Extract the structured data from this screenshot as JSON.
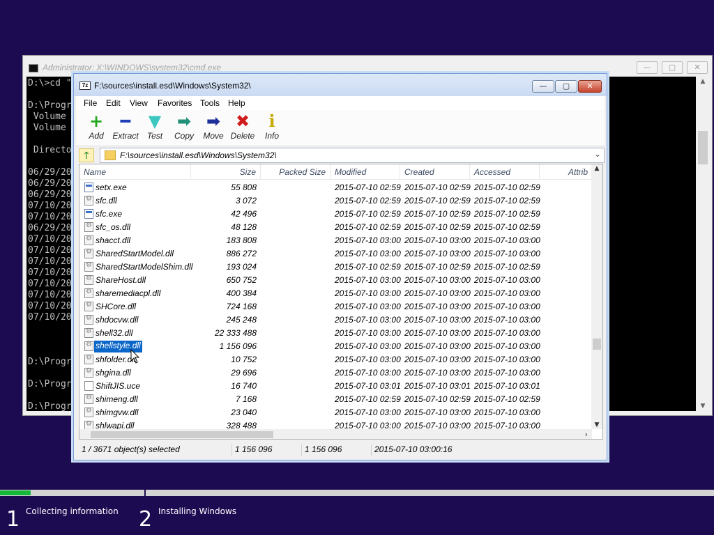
{
  "cmd": {
    "title": "Administrator: X:\\WINDOWS\\system32\\cmd.exe",
    "min_glyph": "—",
    "max_glyph": "▢",
    "close_glyph": "✕",
    "lines": [
      "D:\\>cd \"",
      "",
      "D:\\Progr",
      " Volume",
      " Volume",
      "",
      " Directo",
      "",
      "06/29/20",
      "06/29/20",
      "06/29/20",
      "07/10/20",
      "07/10/20",
      "06/29/20",
      "07/10/20",
      "07/10/20",
      "07/10/20",
      "07/10/20",
      "07/10/20",
      "07/10/20",
      "07/10/20",
      "07/10/20",
      "",
      "",
      "",
      "D:\\Progr",
      "",
      "D:\\Progr",
      "",
      "D:\\Progr"
    ]
  },
  "filemanager": {
    "app_icon": "7z",
    "title": "F:\\sources\\install.esd\\Windows\\System32\\",
    "min_glyph": "—",
    "max_glyph": "▢",
    "close_glyph": "✕",
    "menu": [
      "File",
      "Edit",
      "View",
      "Favorites",
      "Tools",
      "Help"
    ],
    "toolbar": [
      {
        "label": "Add",
        "icon": "plus-icon",
        "glyph": "+",
        "color": "#23a81e"
      },
      {
        "label": "Extract",
        "icon": "minus-icon",
        "glyph": "━",
        "color": "#1f3fb4"
      },
      {
        "label": "Test",
        "icon": "check-icon",
        "glyph": "▼",
        "color": "#3cc8c0"
      },
      {
        "label": "Copy",
        "icon": "copy-arrow-icon",
        "glyph": "➡",
        "color": "#23907a"
      },
      {
        "label": "Move",
        "icon": "move-arrow-icon",
        "glyph": "➡",
        "color": "#1f2f9a"
      },
      {
        "label": "Delete",
        "icon": "delete-x-icon",
        "glyph": "✖",
        "color": "#d01c1c"
      },
      {
        "label": "Info",
        "icon": "info-icon",
        "glyph": "i",
        "color": "#c8a800"
      }
    ],
    "address": "F:\\sources\\install.esd\\Windows\\System32\\",
    "up_glyph": "↑",
    "dropdown_glyph": "⌄",
    "columns": {
      "name": "Name",
      "size": "Size",
      "packed": "Packed Size",
      "modified": "Modified",
      "created": "Created",
      "accessed": "Accessed",
      "attrib": "Attrib"
    },
    "rows": [
      {
        "icon": "exe",
        "name": "setx.exe",
        "size": "55 808",
        "modified": "2015-07-10 02:59",
        "created": "2015-07-10 02:59",
        "accessed": "2015-07-10 02:59"
      },
      {
        "icon": "dll",
        "name": "sfc.dll",
        "size": "3 072",
        "modified": "2015-07-10 02:59",
        "created": "2015-07-10 02:59",
        "accessed": "2015-07-10 02:59"
      },
      {
        "icon": "exe",
        "name": "sfc.exe",
        "size": "42 496",
        "modified": "2015-07-10 02:59",
        "created": "2015-07-10 02:59",
        "accessed": "2015-07-10 02:59"
      },
      {
        "icon": "dll",
        "name": "sfc_os.dll",
        "size": "48 128",
        "modified": "2015-07-10 02:59",
        "created": "2015-07-10 02:59",
        "accessed": "2015-07-10 02:59"
      },
      {
        "icon": "dll",
        "name": "shacct.dll",
        "size": "183 808",
        "modified": "2015-07-10 03:00",
        "created": "2015-07-10 03:00",
        "accessed": "2015-07-10 03:00"
      },
      {
        "icon": "dll",
        "name": "SharedStartModel.dll",
        "size": "886 272",
        "modified": "2015-07-10 03:00",
        "created": "2015-07-10 03:00",
        "accessed": "2015-07-10 03:00"
      },
      {
        "icon": "dll",
        "name": "SharedStartModelShim.dll",
        "size": "193 024",
        "modified": "2015-07-10 02:59",
        "created": "2015-07-10 02:59",
        "accessed": "2015-07-10 02:59"
      },
      {
        "icon": "dll",
        "name": "ShareHost.dll",
        "size": "650 752",
        "modified": "2015-07-10 03:00",
        "created": "2015-07-10 03:00",
        "accessed": "2015-07-10 03:00"
      },
      {
        "icon": "dll",
        "name": "sharemediacpl.dll",
        "size": "400 384",
        "modified": "2015-07-10 03:00",
        "created": "2015-07-10 03:00",
        "accessed": "2015-07-10 03:00"
      },
      {
        "icon": "dll",
        "name": "SHCore.dll",
        "size": "724 168",
        "modified": "2015-07-10 03:00",
        "created": "2015-07-10 03:00",
        "accessed": "2015-07-10 03:00"
      },
      {
        "icon": "dll",
        "name": "shdocvw.dll",
        "size": "245 248",
        "modified": "2015-07-10 03:00",
        "created": "2015-07-10 03:00",
        "accessed": "2015-07-10 03:00"
      },
      {
        "icon": "dll",
        "name": "shell32.dll",
        "size": "22 333 488",
        "modified": "2015-07-10 03:00",
        "created": "2015-07-10 03:00",
        "accessed": "2015-07-10 03:00"
      },
      {
        "icon": "dll",
        "name": "shellstyle.dll",
        "size": "1 156 096",
        "modified": "2015-07-10 03:00",
        "created": "2015-07-10 03:00",
        "accessed": "2015-07-10 03:00",
        "selected": true
      },
      {
        "icon": "dll",
        "name": "shfolder.dll",
        "size": "10 752",
        "modified": "2015-07-10 03:00",
        "created": "2015-07-10 03:00",
        "accessed": "2015-07-10 03:00"
      },
      {
        "icon": "dll",
        "name": "shgina.dll",
        "size": "29 696",
        "modified": "2015-07-10 03:00",
        "created": "2015-07-10 03:00",
        "accessed": "2015-07-10 03:00"
      },
      {
        "icon": "doc",
        "name": "ShiftJIS.uce",
        "size": "16 740",
        "modified": "2015-07-10 03:01",
        "created": "2015-07-10 03:01",
        "accessed": "2015-07-10 03:01"
      },
      {
        "icon": "dll",
        "name": "shimeng.dll",
        "size": "7 168",
        "modified": "2015-07-10 02:59",
        "created": "2015-07-10 02:59",
        "accessed": "2015-07-10 02:59"
      },
      {
        "icon": "dll",
        "name": "shimgvw.dll",
        "size": "23 040",
        "modified": "2015-07-10 03:00",
        "created": "2015-07-10 03:00",
        "accessed": "2015-07-10 03:00"
      },
      {
        "icon": "dll",
        "name": "shlwapi.dll",
        "size": "328 488",
        "modified": "2015-07-10 03:00",
        "created": "2015-07-10 03:00",
        "accessed": "2015-07-10 03:00"
      }
    ],
    "status": {
      "selection": "1 / 3671 object(s) selected",
      "size": "1 156 096",
      "packed": "1 156 096",
      "date": "2015-07-10 03:00:16"
    }
  },
  "setup": {
    "progress": 0.043,
    "accent": "#16b83a",
    "steps": [
      {
        "number": "1",
        "label": "Collecting information"
      },
      {
        "number": "2",
        "label": "Installing Windows"
      }
    ]
  }
}
